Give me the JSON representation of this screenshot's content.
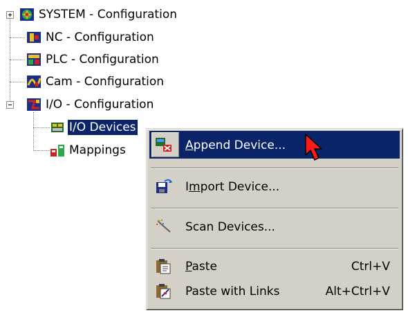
{
  "tree": {
    "nodes": [
      {
        "label": "SYSTEM - Configuration",
        "icon": "system-config-icon",
        "expander": "plus"
      },
      {
        "label": "NC - Configuration",
        "icon": "nc-config-icon"
      },
      {
        "label": "PLC - Configuration",
        "icon": "plc-config-icon"
      },
      {
        "label": "Cam - Configuration",
        "icon": "cam-config-icon"
      },
      {
        "label": "I/O - Configuration",
        "icon": "io-config-icon",
        "expander": "minus"
      },
      {
        "label": "I/O Devices",
        "icon": "io-devices-icon",
        "selected": true
      },
      {
        "label": "Mappings",
        "icon": "mappings-icon"
      }
    ]
  },
  "context_menu": {
    "items": [
      {
        "label": "Append Device...",
        "mnemonic": "A",
        "rest": "ppend Device...",
        "icon": "append-device-icon",
        "highlighted": true
      },
      {
        "label": "Import Device...",
        "pre": "I",
        "mnemonic": "m",
        "rest": "port Device...",
        "icon": "import-device-icon"
      },
      {
        "label": "Scan Devices...",
        "icon": "scan-devices-icon"
      },
      {
        "label": "Paste",
        "mnemonic": "P",
        "rest": "aste",
        "shortcut": "Ctrl+V",
        "icon": "paste-icon"
      },
      {
        "label": "Paste with Links",
        "shortcut": "Alt+Ctrl+V",
        "icon": "paste-with-links-icon"
      }
    ]
  },
  "colors": {
    "selection": "#0a246a",
    "menu_bg": "#d4d0c8",
    "cursor": "#ff0000"
  }
}
